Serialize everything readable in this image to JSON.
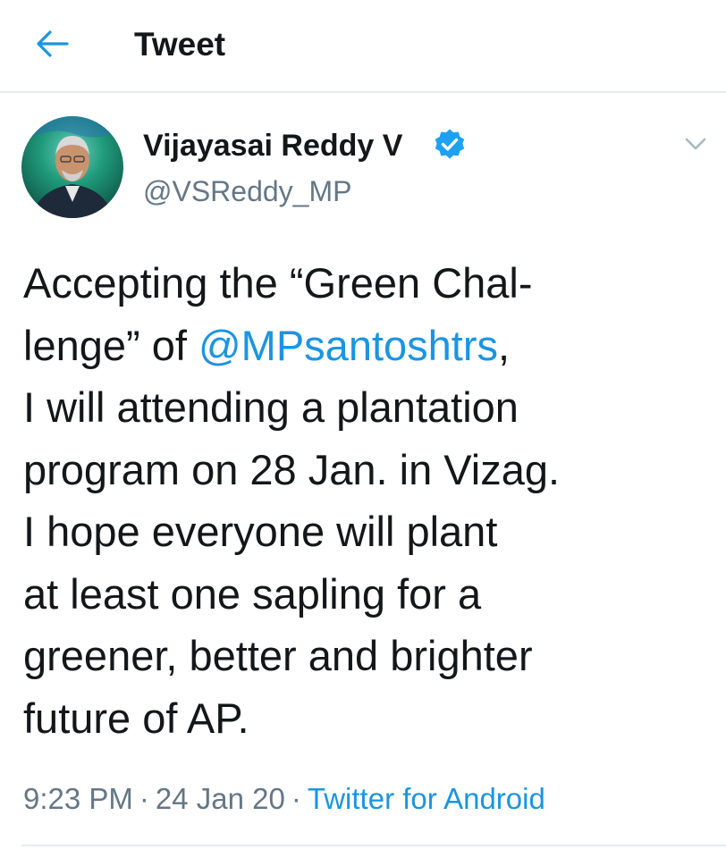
{
  "header": {
    "title": "Tweet",
    "back_icon": "arrow-left-icon"
  },
  "author": {
    "display_name": "Vijayasai Reddy V",
    "handle": "@VSReddy_MP",
    "verified": true,
    "avatar_icon": "profile-photo"
  },
  "tweet": {
    "lines": [
      {
        "text": "Accepting the “Green Chal-"
      },
      {
        "text": "lenge” of ",
        "mention": "@MPsantoshtrs",
        "after": ","
      },
      {
        "text": "I will attending a plantation"
      },
      {
        "text": "program on 28 Jan. in Vizag."
      },
      {
        "text": "I hope everyone will plant"
      },
      {
        "text": "at least one sapling for a"
      },
      {
        "text": "greener, better and brighter"
      },
      {
        "text": "future of AP."
      }
    ]
  },
  "meta": {
    "time": "9:23 PM",
    "separator": "·",
    "date": "24 Jan 20",
    "source": "Twitter for Android"
  },
  "colors": {
    "accent": "#1b95e0",
    "muted": "#657786",
    "text": "#14171a",
    "divider": "#e6ecf0"
  }
}
